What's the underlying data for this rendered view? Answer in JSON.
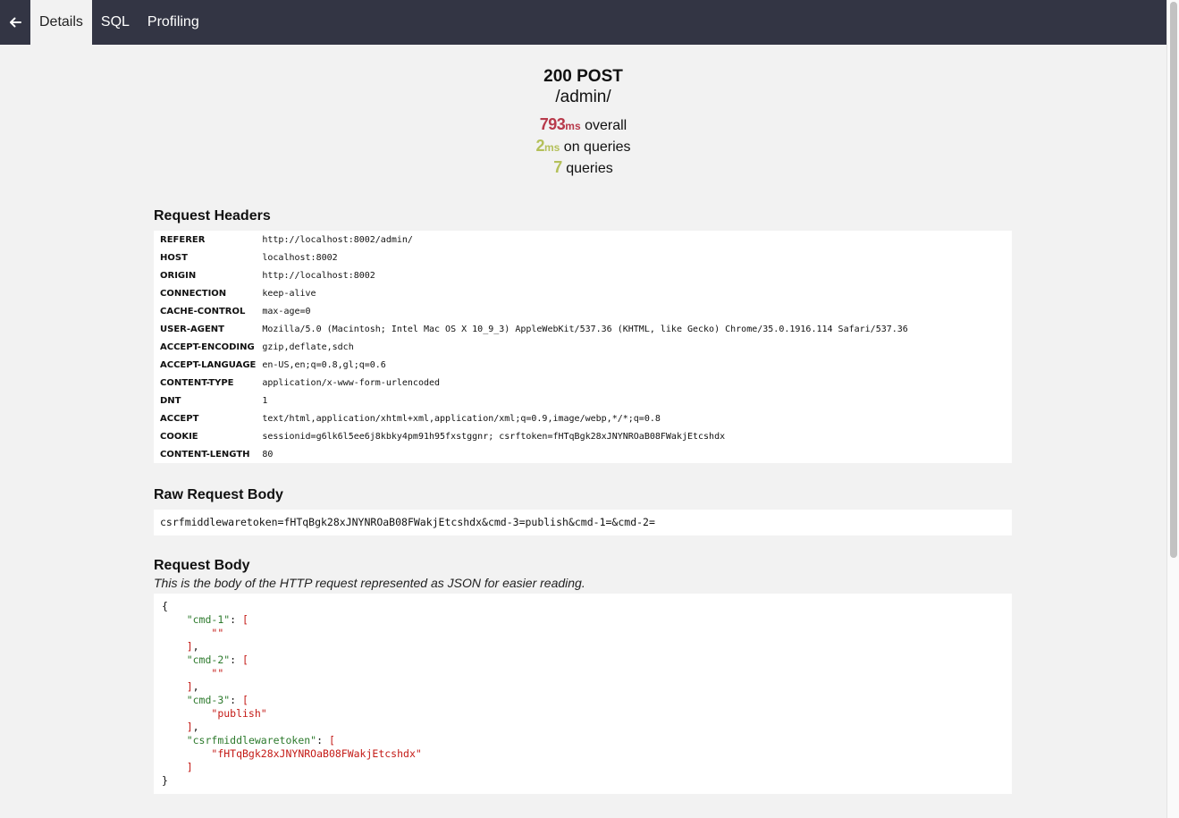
{
  "nav": {
    "back_icon": "arrow-left-icon",
    "tabs": [
      {
        "label": "Details",
        "active": true
      },
      {
        "label": "SQL",
        "active": false
      },
      {
        "label": "Profiling",
        "active": false
      }
    ]
  },
  "summary": {
    "status": "200 POST",
    "path": "/admin/",
    "overall_value": "793",
    "overall_unit": "ms",
    "overall_label": "overall",
    "queries_time_value": "2",
    "queries_time_unit": "ms",
    "queries_time_label": "on queries",
    "query_count": "7",
    "query_count_label": "queries"
  },
  "request_headers": {
    "title": "Request Headers",
    "rows": [
      {
        "name": "REFERER",
        "value": "http://localhost:8002/admin/"
      },
      {
        "name": "HOST",
        "value": "localhost:8002"
      },
      {
        "name": "ORIGIN",
        "value": "http://localhost:8002"
      },
      {
        "name": "CONNECTION",
        "value": "keep-alive"
      },
      {
        "name": "CACHE-CONTROL",
        "value": "max-age=0"
      },
      {
        "name": "USER-AGENT",
        "value": "Mozilla/5.0 (Macintosh; Intel Mac OS X 10_9_3) AppleWebKit/537.36 (KHTML, like Gecko) Chrome/35.0.1916.114 Safari/537.36"
      },
      {
        "name": "ACCEPT-ENCODING",
        "value": "gzip,deflate,sdch"
      },
      {
        "name": "ACCEPT-LANGUAGE",
        "value": "en-US,en;q=0.8,gl;q=0.6"
      },
      {
        "name": "CONTENT-TYPE",
        "value": "application/x-www-form-urlencoded"
      },
      {
        "name": "DNT",
        "value": "1"
      },
      {
        "name": "ACCEPT",
        "value": "text/html,application/xhtml+xml,application/xml;q=0.9,image/webp,*/*;q=0.8"
      },
      {
        "name": "COOKIE",
        "value": "sessionid=g6lk6l5ee6j8kbky4pm91h95fxstggnr; csrftoken=fHTqBgk28xJNYNROaB08FWakjEtcshdx"
      },
      {
        "name": "CONTENT-LENGTH",
        "value": "80"
      }
    ]
  },
  "raw_body": {
    "title": "Raw Request Body",
    "content": "csrfmiddlewaretoken=fHTqBgk28xJNYNROaB08FWakjEtcshdx&cmd-3=publish&cmd-1=&cmd-2="
  },
  "request_body": {
    "title": "Request Body",
    "note": "This is the body of the HTTP request represented as JSON for easier reading.",
    "entries": [
      {
        "key": "\"cmd-1\"",
        "value": "\"\""
      },
      {
        "key": "\"cmd-2\"",
        "value": "\"\""
      },
      {
        "key": "\"cmd-3\"",
        "value": "\"publish\""
      },
      {
        "key": "\"csrfmiddlewaretoken\"",
        "value": "\"fHTqBgk28xJNYNROaB08FWakjEtcshdx\""
      }
    ]
  }
}
